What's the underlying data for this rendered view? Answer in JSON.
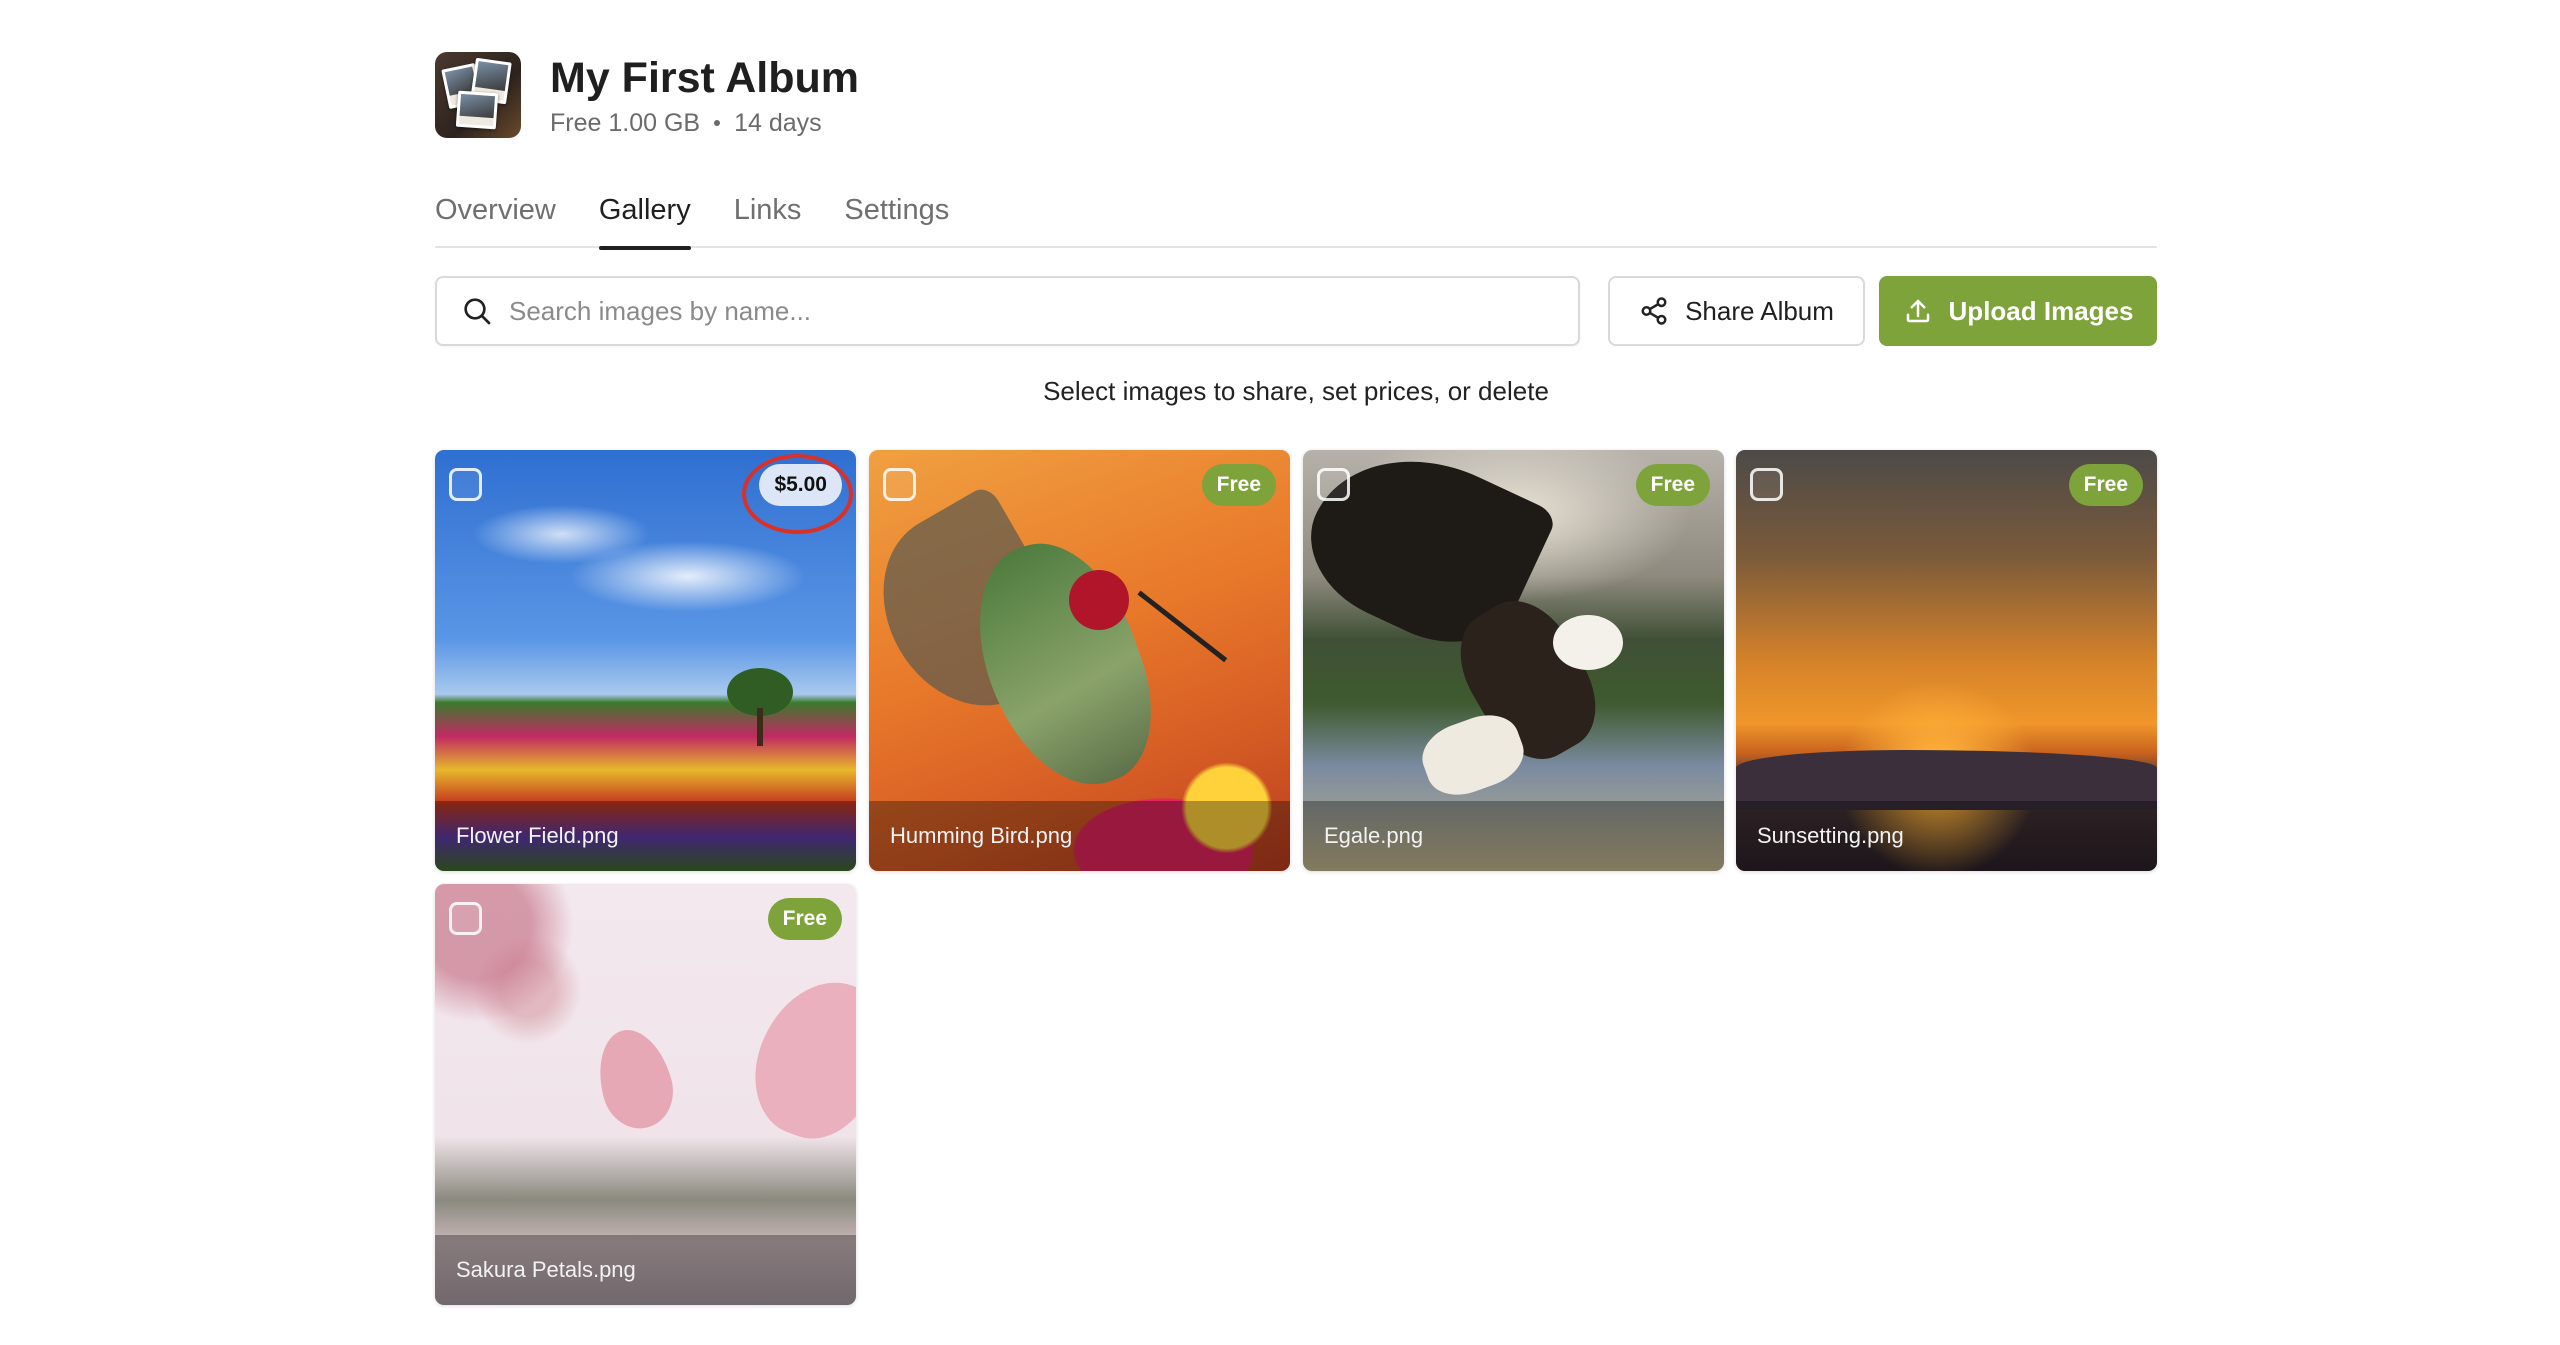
{
  "album": {
    "title": "My First Album",
    "plan": "Free 1.00 GB",
    "duration": "14 days"
  },
  "tabs": [
    {
      "label": "Overview",
      "active": false
    },
    {
      "label": "Gallery",
      "active": true
    },
    {
      "label": "Links",
      "active": false
    },
    {
      "label": "Settings",
      "active": false
    }
  ],
  "toolbar": {
    "search_placeholder": "Search images by name...",
    "search_value": "",
    "share_label": "Share Album",
    "upload_label": "Upload Images"
  },
  "hint": "Select images to share, set prices, or delete",
  "images": [
    {
      "name": "Flower Field.png",
      "price": "$5.00",
      "selected": false,
      "highlighted": true
    },
    {
      "name": "Humming Bird.png",
      "price": "Free",
      "selected": false
    },
    {
      "name": "Egale.png",
      "price": "Free",
      "selected": false
    },
    {
      "name": "Sunsetting.png",
      "price": "Free",
      "selected": false
    },
    {
      "name": "Sakura Petals.png",
      "price": "Free",
      "selected": false
    }
  ],
  "icons": {
    "search": "search-icon",
    "share": "share-icon",
    "upload": "upload-icon"
  },
  "colors": {
    "accent": "#7da33a",
    "highlight_ring": "#d8312a"
  }
}
